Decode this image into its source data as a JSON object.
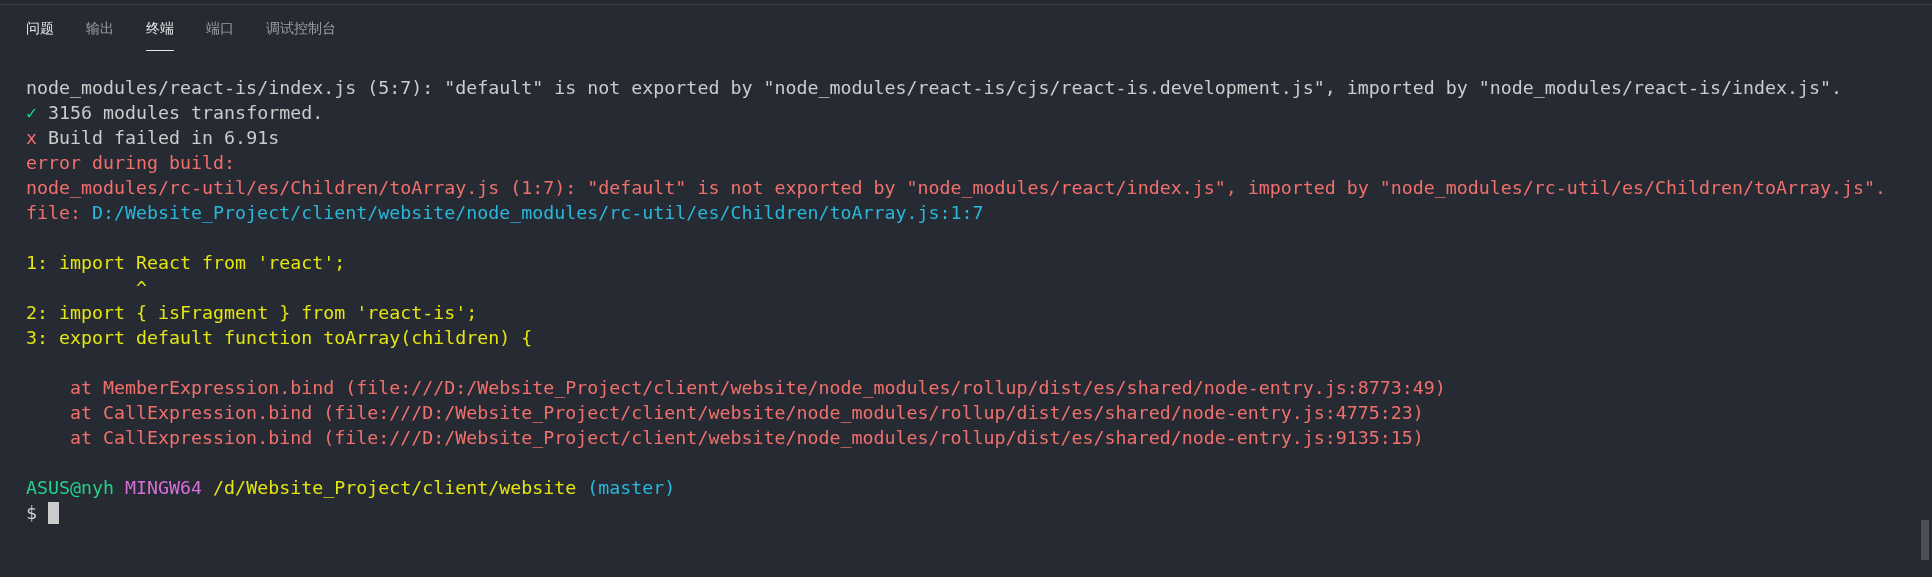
{
  "tabs": [
    {
      "label": "问题",
      "selected": false
    },
    {
      "label": "输出",
      "selected": false
    },
    {
      "label": "终端",
      "selected": true
    },
    {
      "label": "端口",
      "selected": false
    },
    {
      "label": "调试控制台",
      "selected": false
    }
  ],
  "terminal": {
    "lines": [
      {
        "kind": "text",
        "segments": [
          {
            "text": "node_modules/react-is/index.js (5:7): \"default\" is not exported by \"node_modules/react-is/cjs/react-is.development.js\", imported by \"node_modules/react-is/index.js\".",
            "color": "#cccccc"
          }
        ]
      },
      {
        "kind": "text",
        "segments": [
          {
            "text": "✓",
            "color": "#23d18b"
          },
          {
            "text": "3156 modules transformed.",
            "color": "#cccccc"
          }
        ]
      },
      {
        "kind": "text",
        "segments": [
          {
            "text": "x",
            "color": "#f1706c"
          },
          {
            "text": "Build failed in 6.91s",
            "color": "#cccccc"
          }
        ]
      },
      {
        "kind": "text",
        "segments": [
          {
            "text": "error during build:",
            "color": "#f1706c"
          }
        ]
      },
      {
        "kind": "text",
        "segments": [
          {
            "text": "node_modules/rc-util/es/Children/toArray.js (1:7): \"default\" is not exported by \"node_modules/react/index.js\", imported by \"node_modules/rc-util/es/Children/toArray.js\".",
            "color": "#f1706c"
          }
        ]
      },
      {
        "kind": "text",
        "segments": [
          {
            "text": "file:",
            "color": "#f1706c"
          },
          {
            "text": "D:/Website_Project/client/website/node_modules/rc-util/es/Children/toArray.js:1:7",
            "color": "#29b8db"
          }
        ]
      },
      {
        "kind": "blank"
      },
      {
        "kind": "text",
        "segments": [
          {
            "text": "1: import React from 'react';",
            "color": "#e5e510"
          }
        ]
      },
      {
        "kind": "text",
        "segments": [
          {
            "text": "          ^",
            "color": "#e5e510"
          }
        ]
      },
      {
        "kind": "text",
        "segments": [
          {
            "text": "2: import { isFragment } from 'react-is';",
            "color": "#e5e510"
          }
        ]
      },
      {
        "kind": "text",
        "segments": [
          {
            "text": "3: export default function toArray(children) {",
            "color": "#e5e510"
          }
        ]
      },
      {
        "kind": "blank"
      },
      {
        "kind": "text",
        "segments": [
          {
            "text": "    at MemberExpression.bind (file:///D:/Website_Project/client/website/node_modules/rollup/dist/es/shared/node-entry.js:8773:49)",
            "color": "#f1706c"
          }
        ]
      },
      {
        "kind": "text",
        "segments": [
          {
            "text": "    at CallExpression.bind (file:///D:/Website_Project/client/website/node_modules/rollup/dist/es/shared/node-entry.js:4775:23)",
            "color": "#f1706c"
          }
        ]
      },
      {
        "kind": "text",
        "segments": [
          {
            "text": "    at CallExpression.bind (file:///D:/Website_Project/client/website/node_modules/rollup/dist/es/shared/node-entry.js:9135:15)",
            "color": "#f1706c"
          }
        ]
      },
      {
        "kind": "blank"
      },
      {
        "kind": "text",
        "segments": [
          {
            "text": "ASUS@nyh",
            "color": "#23d18b"
          },
          {
            "text": "MINGW64",
            "color": "#d670d6"
          },
          {
            "text": "/d/Website_Project/client/website",
            "color": "#e5e510"
          },
          {
            "text": "(master)",
            "color": "#29b8db"
          }
        ]
      },
      {
        "kind": "prompt",
        "segments": [
          {
            "text": "$",
            "color": "#cccccc"
          }
        ]
      }
    ]
  }
}
